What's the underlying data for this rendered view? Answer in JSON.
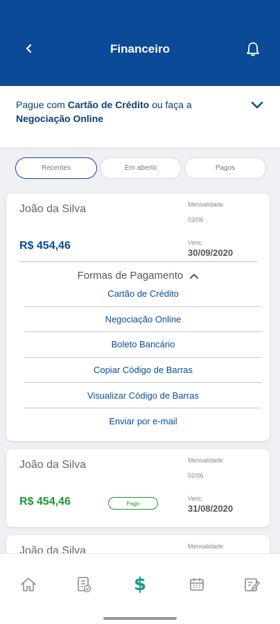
{
  "header": {
    "title": "Financeiro",
    "back_icon": "back-arrow-icon",
    "bell_icon": "bell-icon"
  },
  "promo": {
    "prefix": "Pague com ",
    "highlight1": "Cartão de Crédito",
    "middle": " ou faça a ",
    "highlight2": "Negociação Online"
  },
  "tabs": [
    {
      "label": "Recentes",
      "active": true
    },
    {
      "label": "Em aberto",
      "active": false
    },
    {
      "label": "Pagos",
      "active": false
    }
  ],
  "cards": [
    {
      "name": "João da Silva",
      "mensalidade_label": "Mensalidade",
      "mensalidade": "03/06",
      "amount": "R$ 454,46",
      "venc_label": "Venc.",
      "venc_date": "30/09/2020",
      "payment_title": "Formas de Pagamento",
      "payment_options": [
        "Cartão de Crédito",
        "Negociação Online",
        "Boleto Bancário",
        "Copiar Código de Barras",
        "Visualizar Código de Barras",
        "Enviar por e-mail"
      ]
    },
    {
      "name": "João da Silva",
      "mensalidade_label": "Mensalidade",
      "mensalidade": "02/06",
      "amount": "R$ 454,46",
      "status": "Pago",
      "venc_label": "Venc.",
      "venc_date": "31/08/2020"
    },
    {
      "name": "João da Silva",
      "mensalidade_label": "Mensalidade"
    }
  ],
  "colors": {
    "primary": "#0a4a97",
    "paid": "#1a9a2a",
    "nav_active": "#1a9a8a"
  },
  "nav": [
    "home-icon",
    "document-check-icon",
    "dollar-icon",
    "calendar-icon",
    "edit-note-icon"
  ]
}
